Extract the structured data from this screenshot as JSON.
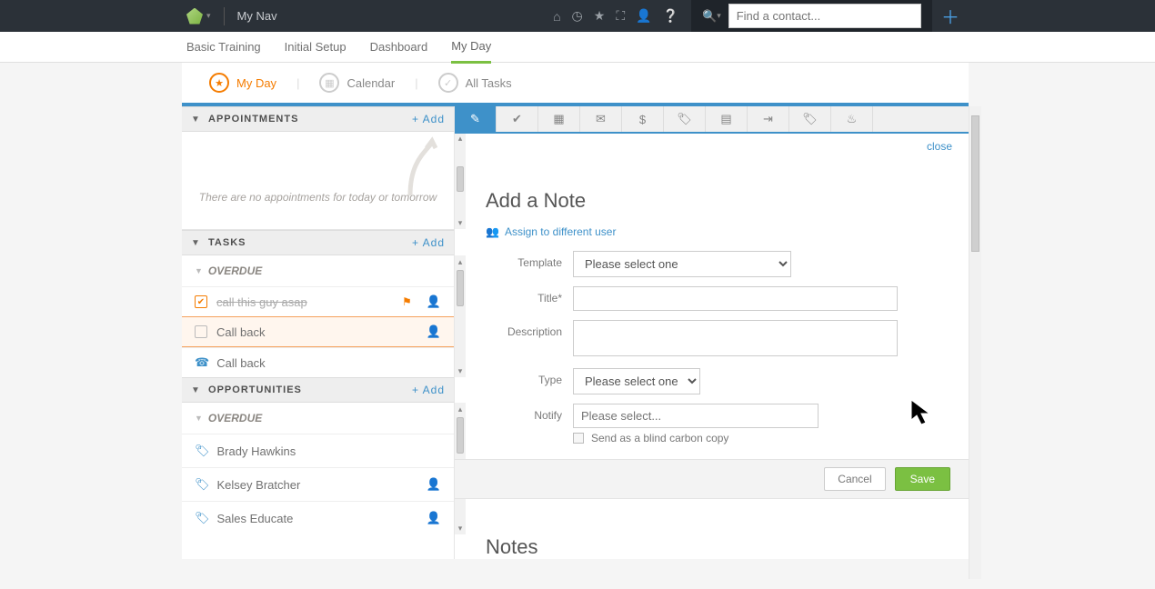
{
  "header": {
    "app_name": "My Nav",
    "search_placeholder": "Find a contact..."
  },
  "main_nav": {
    "items": [
      "Basic Training",
      "Initial Setup",
      "Dashboard",
      "My Day"
    ],
    "active_index": 3
  },
  "sub_tabs": {
    "items": [
      "My Day",
      "Calendar",
      "All Tasks"
    ],
    "active_index": 0
  },
  "appointments": {
    "title": "APPOINTMENTS",
    "add_label": "+ Add",
    "empty_text": "There are no appointments for today or tomorrow"
  },
  "tasks": {
    "title": "TASKS",
    "add_label": "+ Add",
    "group": "OVERDUE",
    "items": [
      {
        "label": "call this guy asap",
        "done": true,
        "flag": true,
        "kind": "checkbox"
      },
      {
        "label": "Call back",
        "done": false,
        "selected": true,
        "kind": "checkbox"
      },
      {
        "label": "Call back",
        "done": false,
        "kind": "phone"
      }
    ]
  },
  "opportunities": {
    "title": "OPPORTUNITIES",
    "add_label": "+ Add",
    "group": "OVERDUE",
    "items": [
      {
        "label": "Brady Hawkins"
      },
      {
        "label": "Kelsey Bratcher"
      },
      {
        "label": "Sales Educate"
      }
    ]
  },
  "note_form": {
    "title": "Add a Note",
    "assign_label": "Assign to different user",
    "labels": {
      "template": "Template",
      "title": "Title*",
      "description": "Description",
      "type": "Type",
      "notify": "Notify"
    },
    "template_placeholder": "Please select one",
    "type_placeholder": "Please select one",
    "notify_placeholder": "Please select...",
    "bcc_label": "Send as a blind carbon copy",
    "cancel": "Cancel",
    "save": "Save",
    "close": "close"
  },
  "notes_section": {
    "title": "Notes"
  }
}
